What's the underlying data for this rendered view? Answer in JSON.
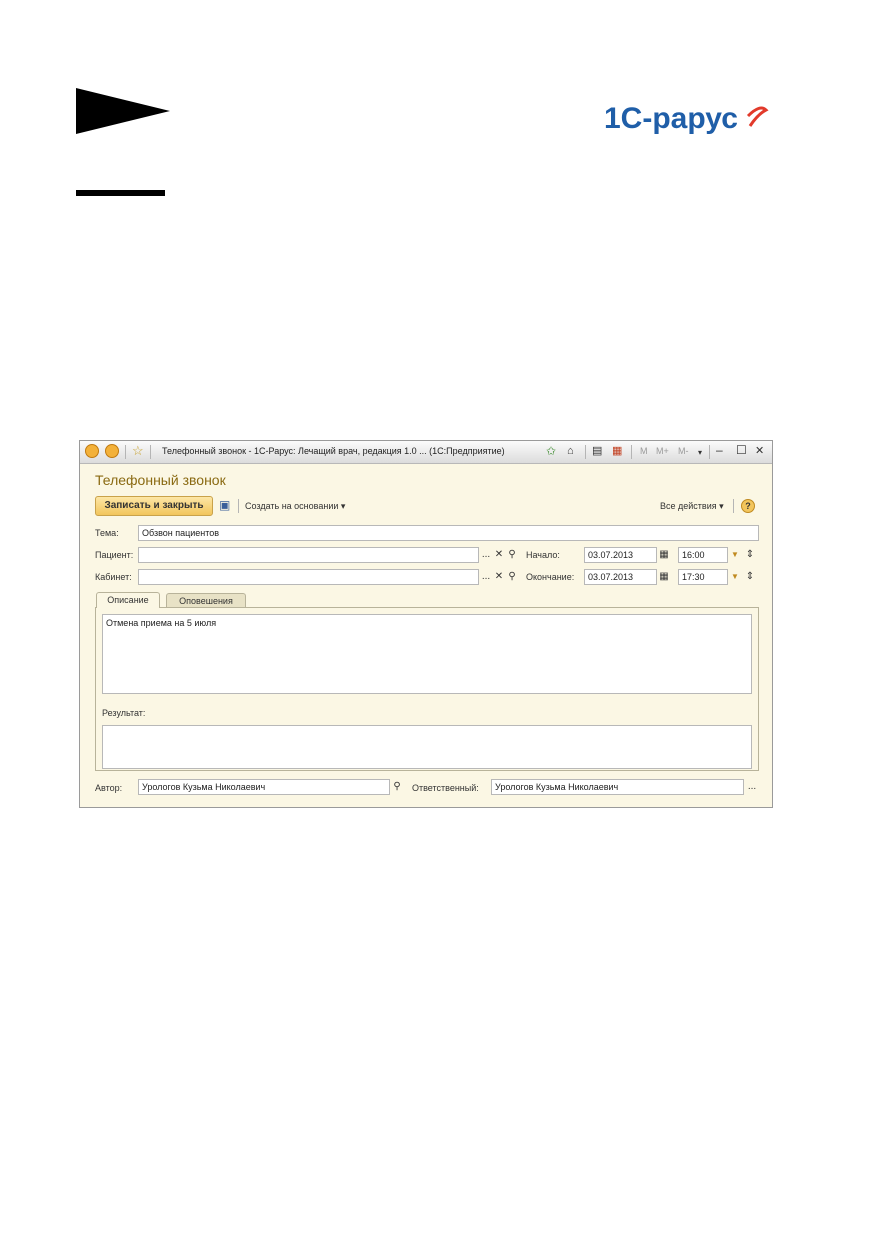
{
  "window": {
    "title": "Телефонный звонок - 1С-Рарус: Лечащий врач, редакция 1.0 ... (1С:Предприятие)",
    "toolbar_glyphs": [
      "M",
      "M+",
      "M-"
    ]
  },
  "form": {
    "title": "Телефонный звонок",
    "save_close_label": "Записать и закрыть",
    "create_based_label": "Создать на основании ▾",
    "all_actions_label": "Все действия ▾",
    "help_glyph": "?"
  },
  "fields": {
    "topic_label": "Тема:",
    "topic_value": "Обзвон пациентов",
    "patient_label": "Пациент:",
    "patient_value": "",
    "cabinet_label": "Кабинет:",
    "cabinet_value": "",
    "start_label": "Начало:",
    "start_date": "03.07.2013",
    "start_time": "16:00",
    "end_label": "Окончание:",
    "end_date": "03.07.2013",
    "end_time": "17:30",
    "author_label": "Автор:",
    "author_value": "Урологов Кузьма Николаевич",
    "responsible_label": "Ответственный:",
    "responsible_value": "Урологов Кузьма Николаевич"
  },
  "tabs": [
    {
      "label": "Описание"
    },
    {
      "label": "Оповешения"
    }
  ],
  "description_text": "Отмена приема на 5 июля",
  "result_label": "Результат:",
  "result_text": "",
  "glyphs": {
    "ellipsis": "...",
    "clear": "✕",
    "search": "⚲",
    "dropdown": "▼",
    "spinner": "⇕"
  },
  "colors": {
    "accent": "#f2c55c",
    "title": "#8a6a12",
    "window_bg": "#fbf7e4",
    "logo_blue": "#1f5ea8",
    "logo_red": "#e23a2b"
  }
}
